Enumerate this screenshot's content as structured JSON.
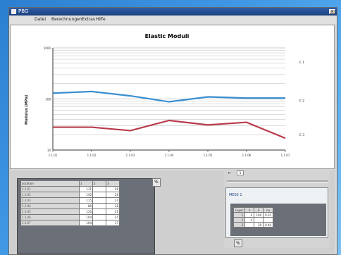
{
  "window": {
    "title": "PBG"
  },
  "menu": [
    "Datei",
    "Berechnungen",
    "Extras",
    "Hilfe"
  ],
  "chart_data": {
    "type": "line",
    "title": "Elastic Moduli",
    "xlabel": "",
    "ylabel": "Modulus [MPa]",
    "y_scale": "log",
    "ylim": [
      10,
      1000
    ],
    "y_ticks": [
      "1000",
      "100",
      "10"
    ],
    "categories": [
      "1.1.01",
      "1.1.02",
      "1.1.03",
      "1.1.04",
      "1.1.05",
      "1.1.06",
      "1.1.07"
    ],
    "grid": "horizontal",
    "series": [
      {
        "color": "#3a8fd0",
        "values": [
          130,
          140,
          115,
          88,
          110,
          104,
          104
        ]
      },
      {
        "color": "#b83a4a",
        "values": [
          28,
          28,
          24,
          38,
          31,
          35,
          17
        ]
      }
    ],
    "right_labels": [
      "E 1",
      "E 2",
      "E 3"
    ]
  },
  "grid_table": {
    "headers": [
      "Location",
      "1",
      "2",
      "3"
    ],
    "rows": [
      [
        "1.1.01",
        "131",
        "",
        "28"
      ],
      [
        "1.1.02",
        "140",
        "",
        "28"
      ],
      [
        "1.1.03",
        "115",
        "",
        "24"
      ],
      [
        "1.1.04",
        "88",
        "",
        "38"
      ],
      [
        "1.1.05",
        "110",
        "",
        "31"
      ],
      [
        "1.1.06",
        "104",
        "",
        "35"
      ],
      [
        "1.1.07",
        "104",
        "",
        "17"
      ]
    ],
    "button": "%"
  },
  "right_panel": {
    "label": "n",
    "input_value": "1",
    "header": "MESS 1",
    "table": {
      "headers": [
        "Layer",
        "h",
        "E",
        "nu"
      ],
      "rows": [
        [
          "1",
          "4",
          "100",
          "0.35"
        ],
        [
          "2",
          "4",
          "",
          ""
        ],
        [
          "3",
          "",
          "20",
          "0.40"
        ]
      ]
    },
    "button": "%"
  },
  "colors": {
    "accent": "#2e5ea8",
    "series1": "#3a8fd0",
    "series2": "#b83a4a"
  }
}
